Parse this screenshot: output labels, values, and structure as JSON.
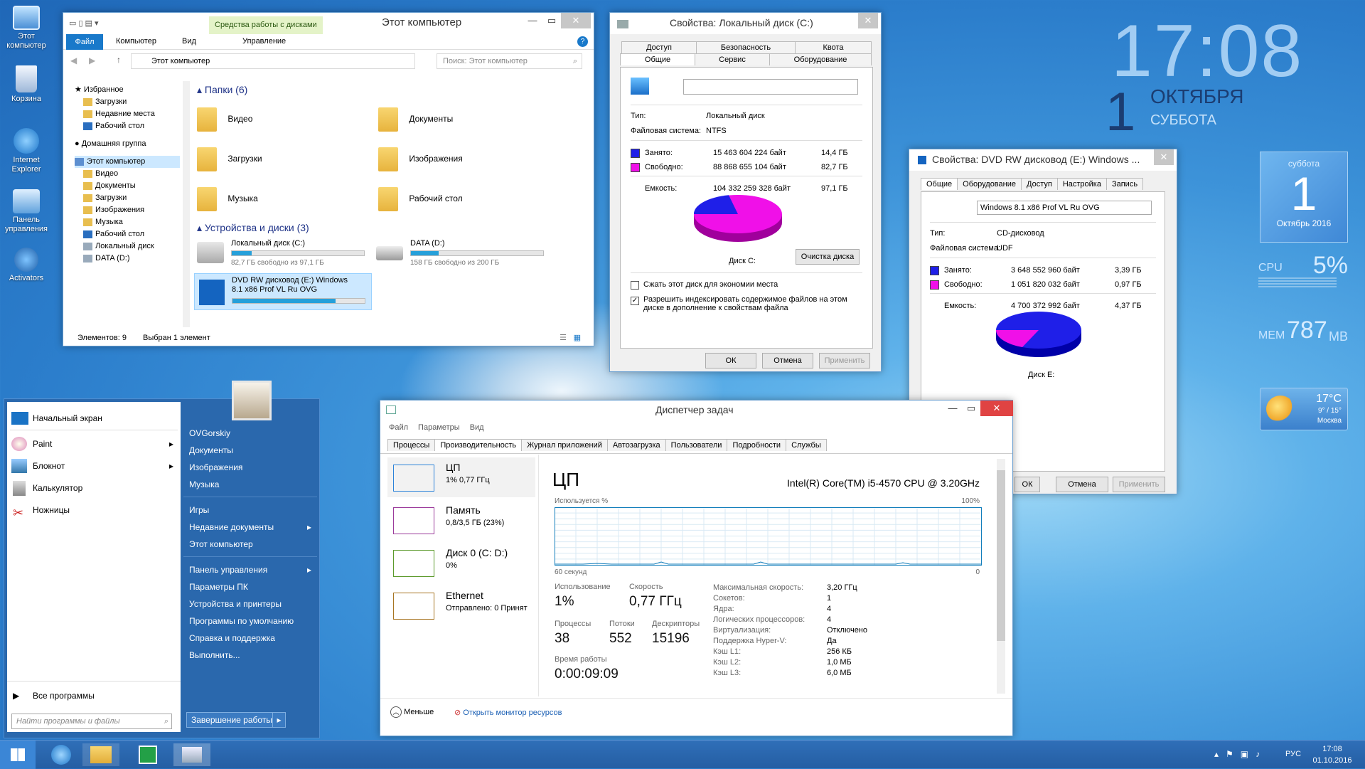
{
  "desktop": {
    "icons": [
      {
        "label": "Этот компьютер"
      },
      {
        "label": "Корзина"
      },
      {
        "label": "Internet Explorer"
      },
      {
        "label": "Панель управления"
      },
      {
        "label": "Activators"
      }
    ]
  },
  "clock": {
    "time": "17:08",
    "day": "1",
    "month": "ОКТЯБРЯ",
    "weekday": "СУББОТА"
  },
  "calendar": {
    "weekday": "суббота",
    "day": "1",
    "month_year": "Октябрь 2016"
  },
  "cpu_gadget": {
    "label": "CPU",
    "value": "5%"
  },
  "mem_gadget": {
    "label": "MEM",
    "value": "787",
    "unit": "MB"
  },
  "weather": {
    "temp": "17°C",
    "range": "9° / 15°",
    "city": "Москва"
  },
  "explorer": {
    "title": "Этот компьютер",
    "contextual_tab": "Средства работы с дисками",
    "ribbon_tabs": [
      "Файл",
      "Компьютер",
      "Вид",
      "Управление"
    ],
    "address": "Этот компьютер",
    "search_placeholder": "Поиск: Этот компьютер",
    "tree": [
      "Избранное",
      "Загрузки",
      "Недавние места",
      "Рабочий стол",
      "Домашняя группа",
      "Этот компьютер",
      "Видео",
      "Документы",
      "Загрузки",
      "Изображения",
      "Музыка",
      "Рабочий стол",
      "Локальный диск",
      "DATA (D:)"
    ],
    "folders_header": "Папки (6)",
    "folders": [
      "Видео",
      "Документы",
      "Загрузки",
      "Изображения",
      "Музыка",
      "Рабочий стол"
    ],
    "devices_header": "Устройства и диски (3)",
    "drives": [
      {
        "name": "Локальный диск (C:)",
        "free": "82,7 ГБ свободно из 97,1 ГБ",
        "fill": 0.15
      },
      {
        "name": "DATA (D:)",
        "free": "158 ГБ свободно из 200 ГБ",
        "fill": 0.21
      },
      {
        "name": "DVD RW дисковод (E:) Windows 8.1 x86 Prof VL Ru OVG",
        "fill": 0.78
      }
    ],
    "status_items": "Элементов: 9",
    "status_selected": "Выбран 1 элемент"
  },
  "propC": {
    "title": "Свойства: Локальный диск (C:)",
    "tabs_top": [
      "Доступ",
      "Безопасность",
      "Квота"
    ],
    "tabs_bottom": [
      "Общие",
      "Сервис",
      "Оборудование"
    ],
    "type_label": "Тип:",
    "type_value": "Локальный диск",
    "fs_label": "Файловая система:",
    "fs_value": "NTFS",
    "used_label": "Занято:",
    "used_bytes": "15 463 604 224 байт",
    "used_gb": "14,4 ГБ",
    "free_label": "Свободно:",
    "free_bytes": "88 868 655 104 байт",
    "free_gb": "82,7 ГБ",
    "cap_label": "Емкость:",
    "cap_bytes": "104 332 259 328 байт",
    "cap_gb": "97,1 ГБ",
    "disk_label": "Диск C:",
    "cleanup": "Очистка диска",
    "compress": "Сжать этот диск для экономии места",
    "index": "Разрешить индексировать содержимое файлов на этом диске в дополнение к свойствам файла",
    "ok": "ОК",
    "cancel": "Отмена",
    "apply": "Применить"
  },
  "propE": {
    "title": "Свойства: DVD RW дисковод (E:) Windows ...",
    "tabs": [
      "Общие",
      "Оборудование",
      "Доступ",
      "Настройка",
      "Запись"
    ],
    "label_value": "Windows 8.1 x86 Prof VL Ru OVG",
    "type_label": "Тип:",
    "type_value": "CD-дисковод",
    "fs_label": "Файловая система:",
    "fs_value": "UDF",
    "used_label": "Занято:",
    "used_bytes": "3 648 552 960 байт",
    "used_gb": "3,39 ГБ",
    "free_label": "Свободно:",
    "free_bytes": "1 051 820 032 байт",
    "free_gb": "0,97 ГБ",
    "cap_label": "Емкость:",
    "cap_bytes": "4 700 372 992 байт",
    "cap_gb": "4,37 ГБ",
    "disk_label": "Диск E:",
    "ok": "ОК",
    "cancel": "Отмена",
    "apply": "Применить"
  },
  "taskmgr": {
    "title": "Диспетчер задач",
    "menu": [
      "Файл",
      "Параметры",
      "Вид"
    ],
    "tabs": [
      "Процессы",
      "Производительность",
      "Журнал приложений",
      "Автозагрузка",
      "Пользователи",
      "Подробности",
      "Службы"
    ],
    "side": [
      {
        "name": "ЦП",
        "sub": "1% 0,77 ГГц"
      },
      {
        "name": "Память",
        "sub": "0,8/3,5 ГБ (23%)"
      },
      {
        "name": "Диск 0 (C: D:)",
        "sub": "0%"
      },
      {
        "name": "Ethernet",
        "sub": "Отправлено: 0 Принят"
      }
    ],
    "heading": "ЦП",
    "cpu_model": "Intel(R) Core(TM) i5-4570 CPU @ 3.20GHz",
    "usage_label": "Используется %",
    "max_label": "100%",
    "time_label": "60 секунд",
    "zero_label": "0",
    "stats": {
      "usage_l": "Использование",
      "usage": "1%",
      "speed_l": "Скорость",
      "speed": "0,77 ГГц",
      "proc_l": "Процессы",
      "proc": "38",
      "threads_l": "Потоки",
      "threads": "552",
      "handles_l": "Дескрипторы",
      "handles": "15196",
      "uptime_l": "Время работы",
      "uptime": "0:00:09:09"
    },
    "details": [
      {
        "k": "Максимальная скорость:",
        "v": "3,20 ГГц"
      },
      {
        "k": "Сокетов:",
        "v": "1"
      },
      {
        "k": "Ядра:",
        "v": "4"
      },
      {
        "k": "Логических процессоров:",
        "v": "4"
      },
      {
        "k": "Виртуализация:",
        "v": "Отключено"
      },
      {
        "k": "Поддержка Hyper-V:",
        "v": "Да"
      },
      {
        "k": "Кэш L1:",
        "v": "256 КБ"
      },
      {
        "k": "Кэш L2:",
        "v": "1,0 МБ"
      },
      {
        "k": "Кэш L3:",
        "v": "6,0 МБ"
      }
    ],
    "less": "Меньше",
    "monitor": "Открыть монитор ресурсов"
  },
  "startmenu": {
    "left": [
      "Начальный экран",
      "Paint",
      "Блокнот",
      "Калькулятор",
      "Ножницы"
    ],
    "all_programs": "Все программы",
    "search_placeholder": "Найти программы и файлы",
    "right": [
      "OVGorskiy",
      "Документы",
      "Изображения",
      "Музыка",
      "Игры",
      "Недавние документы",
      "Этот компьютер",
      "Панель управления",
      "Параметры ПК",
      "Устройства и принтеры",
      "Программы по умолчанию",
      "Справка и поддержка",
      "Выполнить..."
    ],
    "shutdown": "Завершение работы"
  },
  "taskbar": {
    "lang": "РУС",
    "time": "17:08",
    "date": "01.10.2016"
  }
}
